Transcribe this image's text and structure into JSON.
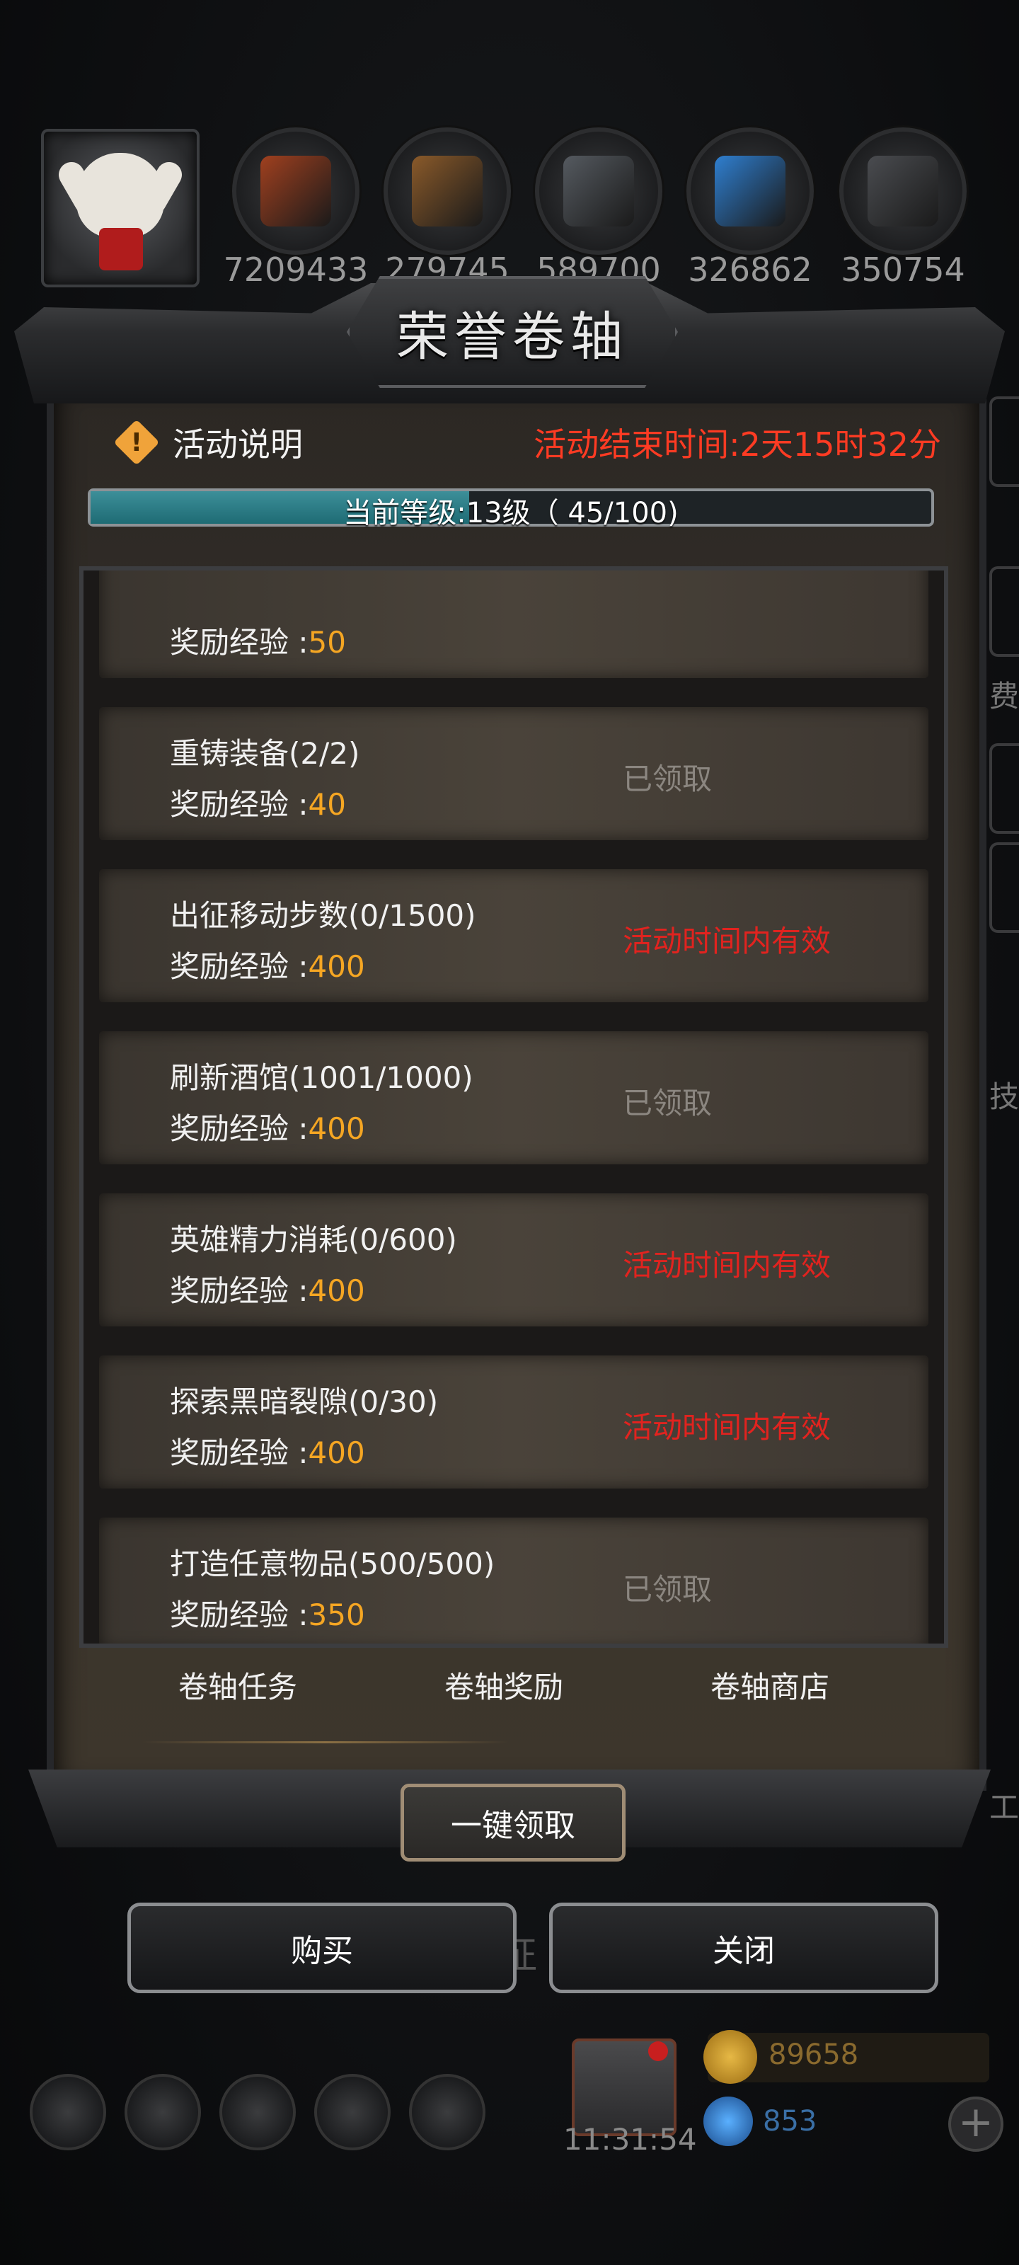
{
  "resources": [
    {
      "name": "meat",
      "value": "7209433",
      "color": "#a0401f"
    },
    {
      "name": "wood",
      "value": "279745",
      "color": "#8a5a2a"
    },
    {
      "name": "iron",
      "value": "589700",
      "color": "#555a60"
    },
    {
      "name": "crystal",
      "value": "326862",
      "color": "#2f7fd0"
    },
    {
      "name": "steel",
      "value": "350754",
      "color": "#4a4c50"
    }
  ],
  "panel": {
    "title": "荣誉卷轴",
    "notice_label": "活动说明",
    "notice_icon": "!",
    "end_time": "活动结束时间:2天15时32分",
    "level_text": "当前等级:13级（ 45/100)",
    "progress_fraction": 0.45
  },
  "tasks": [
    {
      "name": "",
      "exp_label": "奖励经验 :",
      "exp_value": "50",
      "status": ""
    },
    {
      "name": "重铸装备(2/2)",
      "exp_label": "奖励经验 :",
      "exp_value": "40",
      "status": "已领取"
    },
    {
      "name": "出征移动步数(0/1500)",
      "exp_label": "奖励经验 :",
      "exp_value": "400",
      "status": "活动时间内有效"
    },
    {
      "name": "刷新酒馆(1001/1000)",
      "exp_label": "奖励经验 :",
      "exp_value": "400",
      "status": "已领取"
    },
    {
      "name": "英雄精力消耗(0/600)",
      "exp_label": "奖励经验 :",
      "exp_value": "400",
      "status": "活动时间内有效"
    },
    {
      "name": "探索黑暗裂隙(0/30)",
      "exp_label": "奖励经验 :",
      "exp_value": "400",
      "status": "活动时间内有效"
    },
    {
      "name": "打造任意物品(500/500)",
      "exp_label": "奖励经验 :",
      "exp_value": "350",
      "status": "已领取"
    }
  ],
  "tabs": [
    "卷轴任务",
    "卷轴奖励",
    "卷轴商店"
  ],
  "buttons": {
    "claim_all": "一键领取",
    "buy": "购买",
    "close": "关闭"
  },
  "background": {
    "march_text": "出征",
    "side_text_1": "费",
    "side_text_2": "技",
    "side_text_3": "工"
  },
  "bottom": {
    "clock": "11:31:54",
    "gold": "89658",
    "gems": "853",
    "plus": "+"
  }
}
